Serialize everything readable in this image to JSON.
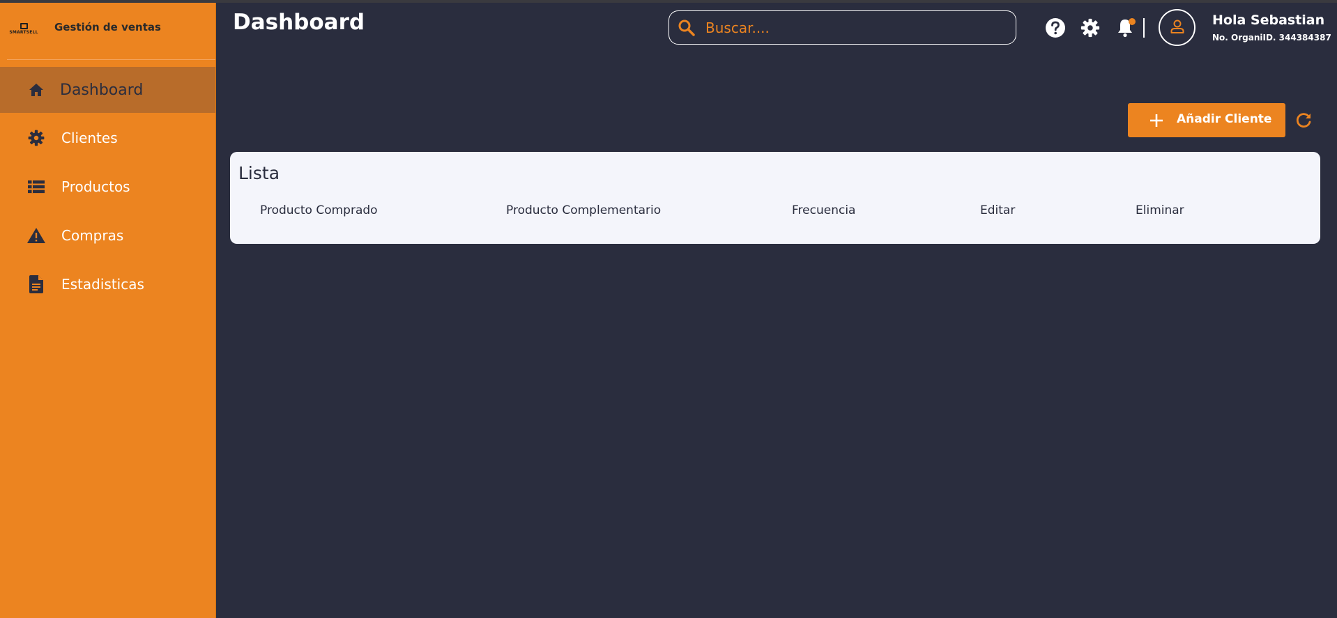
{
  "brand": {
    "logo_text": "SMARTSELL",
    "subtitle": "Gestión de ventas"
  },
  "sidebar": {
    "items": [
      {
        "label": "Dashboard",
        "icon": "home-icon",
        "active": true
      },
      {
        "label": "Clientes",
        "icon": "gear-icon",
        "active": false
      },
      {
        "label": "Productos",
        "icon": "list-icon",
        "active": false
      },
      {
        "label": "Compras",
        "icon": "warning-icon",
        "active": false
      },
      {
        "label": "Estadisticas",
        "icon": "document-icon",
        "active": false
      }
    ]
  },
  "header": {
    "title": "Dashboard",
    "search_placeholder": "Buscar....",
    "icons": [
      "help-icon",
      "gear-icon",
      "bell-icon",
      "user-icon"
    ],
    "user_greeting": "Hola Sebastian",
    "org_id": "No. OrganiID. 344384387"
  },
  "actions": {
    "add_label": "Añadir Cliente"
  },
  "table": {
    "title": "Lista",
    "columns": [
      "Producto Comprado",
      "Producto Complementario",
      "Frecuencia",
      "Editar",
      "Eliminar"
    ],
    "rows": []
  },
  "colors": {
    "accent": "#ec8420",
    "sidebar_active": "#b86c2a",
    "background": "#2a2d3e",
    "card": "#f4f5fb"
  }
}
